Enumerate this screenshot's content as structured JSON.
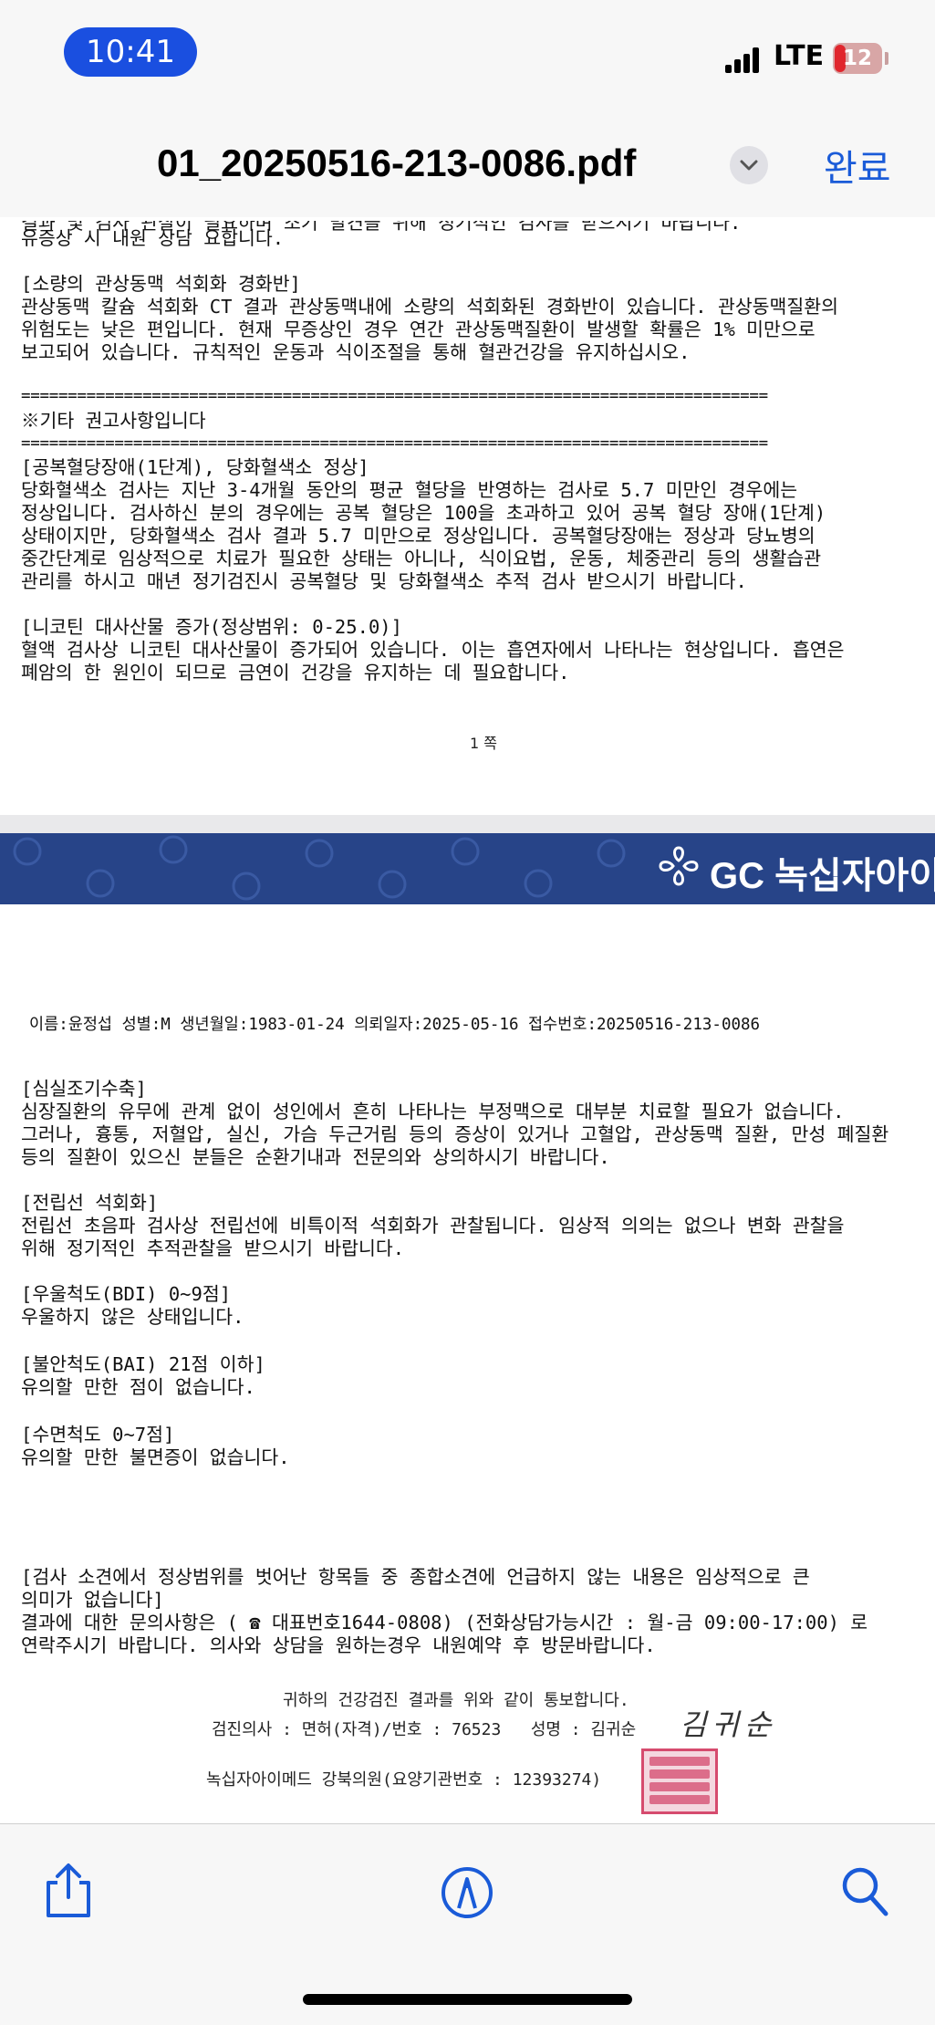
{
  "status": {
    "time": "10:41",
    "network": "LTE",
    "battery": "12"
  },
  "nav": {
    "title": "01_20250516-213-0086.pdf",
    "done": "완료"
  },
  "page1": {
    "lines": [
      "유증상 시 내원 상담 요합니다.",
      "",
      "[소량의 관상동맥 석회화 경화반]",
      "관상동맥 칼슘 석회화 CT 결과 관상동맥내에 소량의 석회화된 경화반이 있습니다. 관상동맥질환의",
      "위험도는 낮은 편입니다. 현재 무증상인 경우 연간 관상동맥질환이 발생할 확률은 1% 미만으로",
      "보고되어 있습니다. 규칙적인 운동과 식이조절을 통해 혈관건강을 유지하십시오.",
      "",
      "================================================================================",
      "※기타 권고사항입니다",
      "================================================================================",
      "[공복혈당장애(1단계), 당화혈색소 정상]",
      "당화혈색소 검사는 지난 3-4개월 동안의 평균 혈당을 반영하는 검사로 5.7 미만인 경우에는",
      "정상입니다. 검사하신 분의 경우에는 공복 혈당은 100을 초과하고 있어 공복 혈당 장애(1단계)",
      "상태이지만, 당화혈색소 검사 결과 5.7 미만으로 정상입니다. 공복혈당장애는 정상과 당뇨병의",
      "중간단계로 임상적으로 치료가 필요한 상태는 아니나, 식이요법, 운동, 체중관리 등의 생활습관",
      "관리를 하시고 매년 정기검진시 공복혈당 및 당화혈색소 추적 검사 받으시기 바랍니다.",
      "",
      "[니코틴 대사산물 증가(정상범위: 0-25.0)]",
      "혈액 검사상 니코틴 대사산물이 증가되어 있습니다. 이는 흡연자에서 나타나는 현상입니다. 흡연은",
      "폐암의 한 원인이 되므로 금연이 건강을 유지하는 데 필요합니다."
    ],
    "page_number": "1 쪽"
  },
  "page2": {
    "brand": "GC 녹십자아이메드",
    "patient_line": "이름:윤정섭 성별:M 생년월일:1983-01-24 의뢰일자:2025-05-16 접수번호:20250516-213-0086",
    "lines": [
      "[심실조기수축]",
      "심장질환의 유무에 관계 없이 성인에서 흔히 나타나는 부정맥으로 대부분 치료할 필요가 없습니다.",
      "그러나, 흉통, 저혈압, 실신, 가슴 두근거림 등의 증상이 있거나 고혈압, 관상동맥 질환, 만성 폐질환",
      "등의 질환이 있으신 분들은 순환기내과 전문의와 상의하시기 바랍니다.",
      "",
      "[전립선 석회화]",
      "전립선 초음파 검사상 전립선에 비특이적 석회화가 관찰됩니다. 임상적 의의는 없으나 변화 관찰을",
      "위해 정기적인 추적관찰을 받으시기 바랍니다.",
      "",
      "[우울척도(BDI) 0~9점]",
      "우울하지 않은 상태입니다.",
      "",
      "[불안척도(BAI) 21점 이하]",
      "유의할 만한 점이 없습니다.",
      "",
      "[수면척도 0~7점]",
      "유의할 만한 불면증이 없습니다."
    ],
    "notice_lines": [
      "[검사 소견에서 정상범위를 벗어난 항목들 중 종합소견에 언급하지 않는 내용은 임상적으로 큰",
      "의미가 없습니다]",
      "결과에 대한 문의사항은 ( ☎ 대표번호1644-0808) (전화상담가능시간 : 월-금 09:00-17:00) 로",
      "연락주시기 바랍니다. 의사와 상담을 원하는경우 내원예약 후 방문바랍니다."
    ],
    "notify": "귀하의 건강검진 결과를 위와 같이 통보합니다.",
    "doctor": "검진의사 : 면허(자격)/번호 : 76523   성명 : 김귀순",
    "signature": "김귀순",
    "clinic": "녹십자아이메드 강북의원(요양기관번호 : 12393274)"
  },
  "colors": {
    "accent": "#1a5bd8",
    "time_pill": "#1a4fe0",
    "banner": "#274488",
    "stamp": "#d64b6e"
  },
  "toolbar": {
    "icons": [
      "share-icon",
      "markup-icon",
      "search-icon"
    ]
  }
}
